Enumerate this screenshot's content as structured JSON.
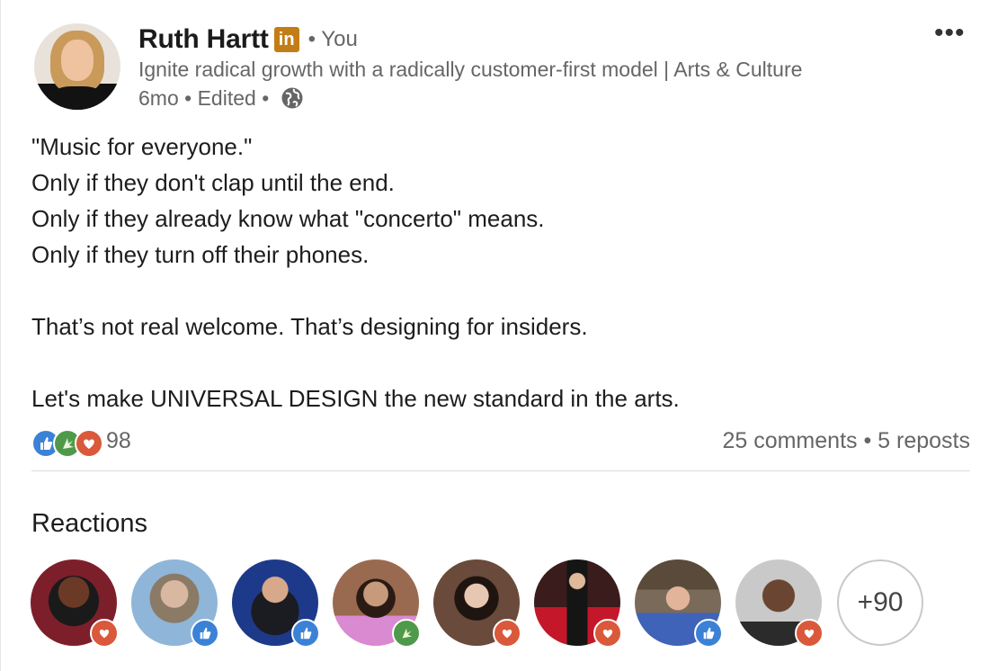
{
  "author": {
    "name": "Ruth Hartt",
    "badge": "in",
    "relation": "• You",
    "headline": "Ignite radical growth with a radically customer-first model | Arts & Culture",
    "time": "6mo",
    "sep1": " • ",
    "edited": "Edited",
    "sep2": " • ",
    "visibility_icon": "globe-icon"
  },
  "post": {
    "lines": [
      "\"Music for everyone.\"",
      "Only if they don't clap until the end.",
      "Only if they already know what \"concerto\" means.",
      "Only if they turn off their phones.",
      "",
      "That’s not real welcome. That’s designing for insiders.",
      "",
      "Let's make UNIVERSAL DESIGN the new standard in the arts."
    ]
  },
  "social": {
    "reaction_count": "98",
    "comments_reposts": "25 comments • 5 reposts",
    "reaction_types": [
      "like",
      "celebrate",
      "love"
    ]
  },
  "reactions": {
    "title": "Reactions",
    "more": "+90",
    "people": [
      {
        "reaction": "love"
      },
      {
        "reaction": "like"
      },
      {
        "reaction": "like"
      },
      {
        "reaction": "celebrate"
      },
      {
        "reaction": "love"
      },
      {
        "reaction": "love"
      },
      {
        "reaction": "like"
      },
      {
        "reaction": "love"
      }
    ]
  },
  "menu": {
    "more": "•••"
  },
  "colors": {
    "like": "#3b82d6",
    "celebrate": "#4f9a4a",
    "love": "#d9593a",
    "premium_badge": "#c37d16"
  }
}
